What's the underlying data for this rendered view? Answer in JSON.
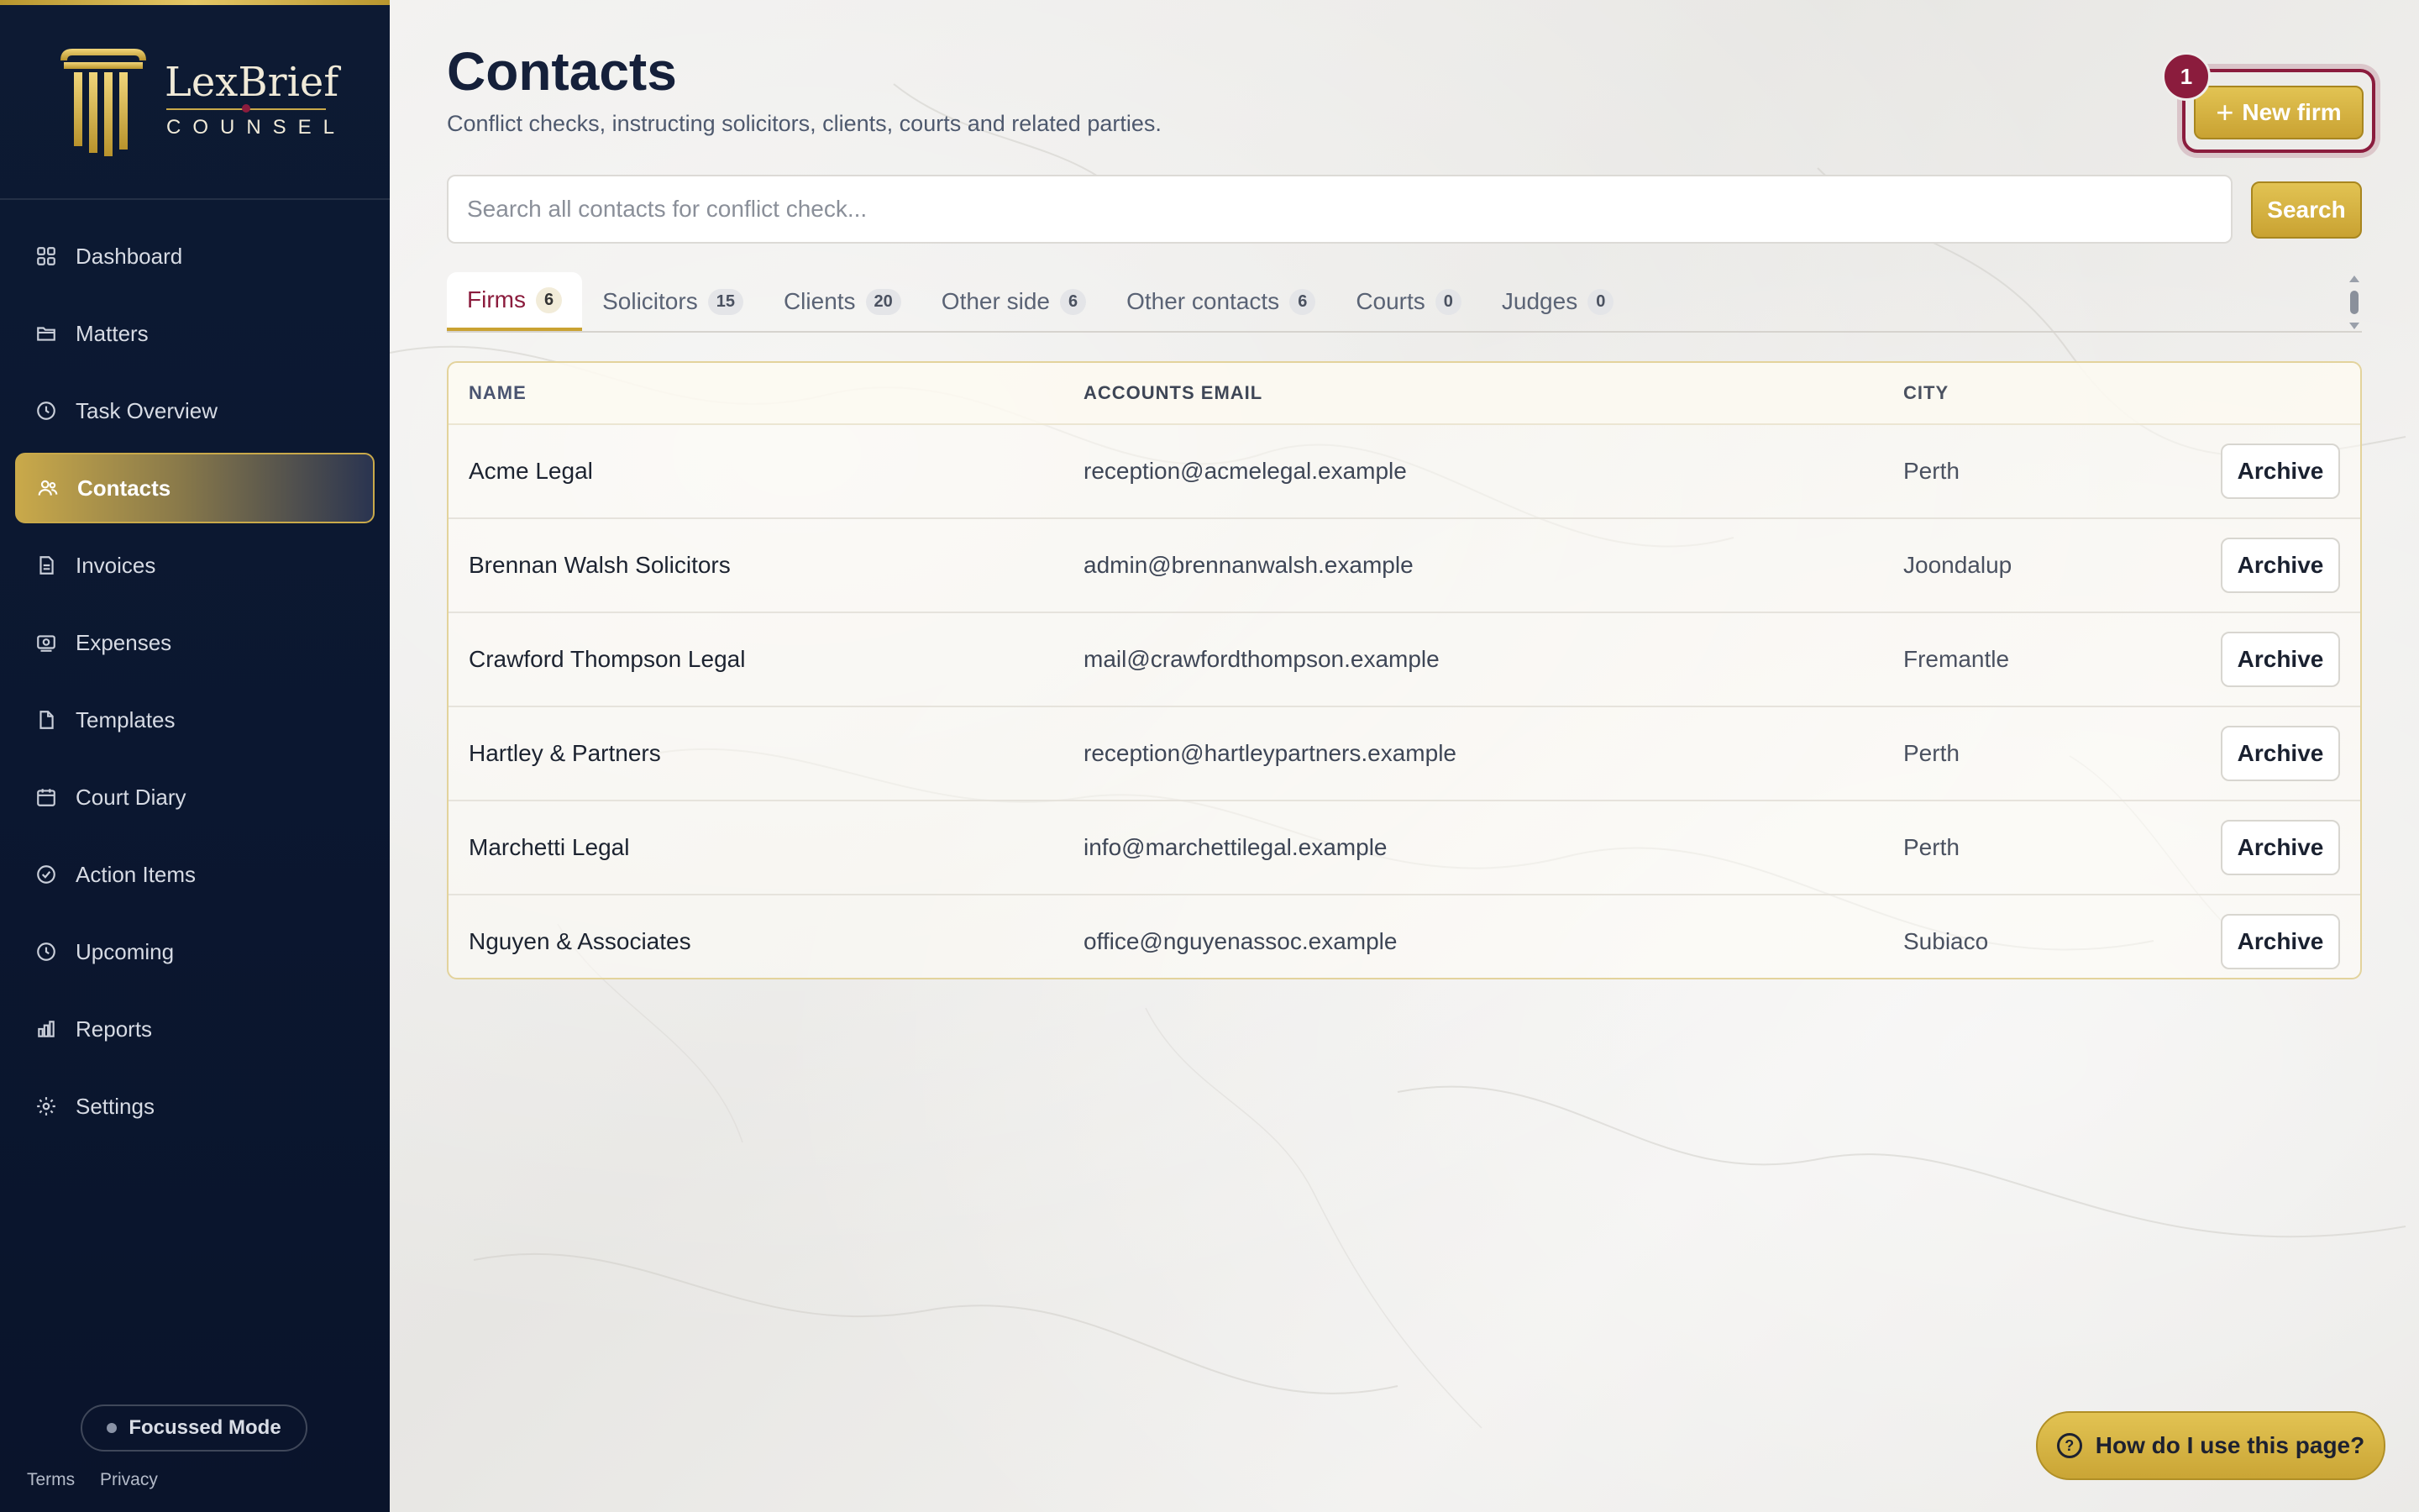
{
  "brand": {
    "name": "LexBrief",
    "sub": "COUNSEL"
  },
  "sidebar": {
    "items": [
      {
        "label": "Dashboard",
        "icon": "grid-icon"
      },
      {
        "label": "Matters",
        "icon": "folder-icon"
      },
      {
        "label": "Task Overview",
        "icon": "clock-icon"
      },
      {
        "label": "Contacts",
        "icon": "users-icon",
        "active": true
      },
      {
        "label": "Invoices",
        "icon": "invoice-icon"
      },
      {
        "label": "Expenses",
        "icon": "receipt-icon"
      },
      {
        "label": "Templates",
        "icon": "file-icon"
      },
      {
        "label": "Court Diary",
        "icon": "calendar-icon"
      },
      {
        "label": "Action Items",
        "icon": "check-circle-icon"
      },
      {
        "label": "Upcoming",
        "icon": "clock-icon"
      },
      {
        "label": "Reports",
        "icon": "bar-chart-icon"
      },
      {
        "label": "Settings",
        "icon": "gear-icon"
      }
    ],
    "focus_mode": "Focussed Mode",
    "footer": {
      "terms": "Terms",
      "privacy": "Privacy"
    }
  },
  "header": {
    "title": "Contacts",
    "subtitle": "Conflict checks, instructing solicitors, clients, courts and related parties.",
    "new_button": "New firm",
    "step_badge": "1"
  },
  "search": {
    "placeholder": "Search all contacts for conflict check...",
    "value": "",
    "button": "Search"
  },
  "tabs": [
    {
      "label": "Firms",
      "count": "6",
      "active": true
    },
    {
      "label": "Solicitors",
      "count": "15"
    },
    {
      "label": "Clients",
      "count": "20"
    },
    {
      "label": "Other side",
      "count": "6"
    },
    {
      "label": "Other contacts",
      "count": "6"
    },
    {
      "label": "Courts",
      "count": "0"
    },
    {
      "label": "Judges",
      "count": "0"
    }
  ],
  "table": {
    "columns": {
      "name": "NAME",
      "email": "ACCOUNTS EMAIL",
      "city": "CITY"
    },
    "action_label": "Archive",
    "rows": [
      {
        "name": "Acme Legal",
        "email": "reception@acmelegal.example",
        "city": "Perth"
      },
      {
        "name": "Brennan Walsh Solicitors",
        "email": "admin@brennanwalsh.example",
        "city": "Joondalup"
      },
      {
        "name": "Crawford Thompson Legal",
        "email": "mail@crawfordthompson.example",
        "city": "Fremantle"
      },
      {
        "name": "Hartley & Partners",
        "email": "reception@hartleypartners.example",
        "city": "Perth"
      },
      {
        "name": "Marchetti Legal",
        "email": "info@marchettilegal.example",
        "city": "Perth"
      },
      {
        "name": "Nguyen & Associates",
        "email": "office@nguyenassoc.example",
        "city": "Subiaco"
      }
    ]
  },
  "help": {
    "label": "How do I use this page?"
  },
  "colors": {
    "navy": "#0d1a33",
    "gold": "#c9a232",
    "maroon": "#8b1c3d"
  }
}
